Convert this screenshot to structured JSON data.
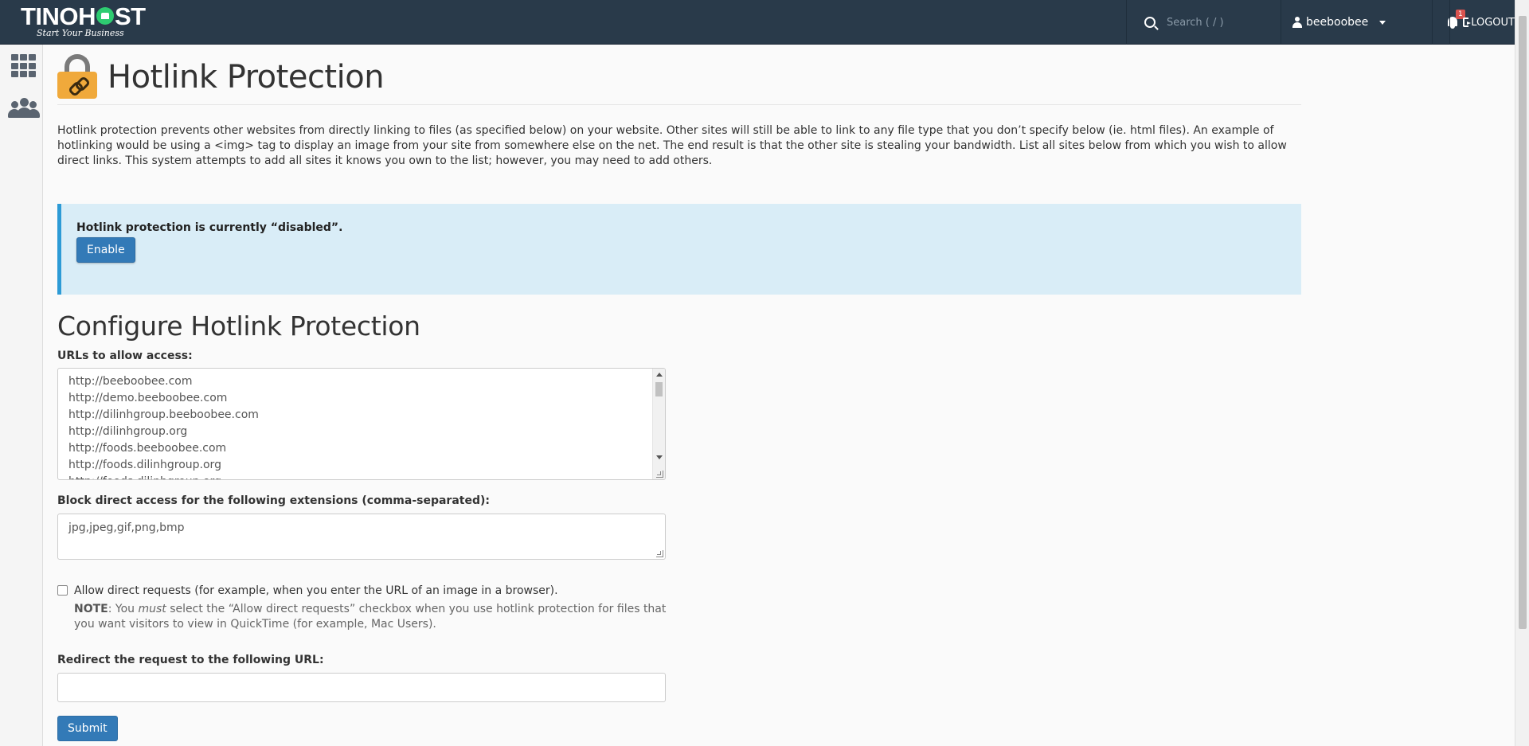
{
  "header": {
    "logo_text_left": "TINO",
    "logo_text_h": "H",
    "logo_text_right": "ST",
    "logo_tagline": "Start Your Business",
    "search_placeholder": "Search ( / )",
    "username": "beeboobee",
    "notification_count": "1",
    "logout_label": "LOGOUT"
  },
  "sidebar": {
    "items": [
      {
        "icon": "grid-icon"
      },
      {
        "icon": "users-icon"
      }
    ]
  },
  "page": {
    "title": "Hotlink Protection",
    "description": "Hotlink protection prevents other websites from directly linking to files (as specified below) on your website. Other sites will still be able to link to any file type that you don’t specify below (ie. html files). An example of hotlinking would be using a <img> tag to display an image from your site from somewhere else on the net. The end result is that the other site is stealing your bandwidth. List all sites below from which you wish to allow direct links. This system attempts to add all sites it knows you own to the list; however, you may need to add others."
  },
  "status": {
    "text": "Hotlink protection is currently “disabled”.",
    "enable_label": "Enable",
    "accent": "#2d9bd6",
    "background": "#d9edf7"
  },
  "config": {
    "title": "Configure Hotlink Protection",
    "urls_label": "URLs to allow access:",
    "urls": [
      "http://beeboobee.com",
      "http://demo.beeboobee.com",
      "http://dilinhgroup.beeboobee.com",
      "http://dilinhgroup.org",
      "http://foods.beeboobee.com",
      "http://foods.dilinhgroup.org",
      "http://foods.dilinhgroup.org"
    ],
    "extensions_label": "Block direct access for the following extensions (comma-separated):",
    "extensions_value": "jpg,jpeg,gif,png,bmp",
    "allow_direct_label": "Allow direct requests (for example, when you enter the URL of an image in a browser).",
    "note_prefix": "NOTE",
    "note_part1": ": You ",
    "note_emphasis": "must",
    "note_part2": " select the “Allow direct requests” checkbox when you use hotlink protection for files that you want visitors to view in QuickTime (for example, Mac Users).",
    "redirect_label": "Redirect the request to the following URL:",
    "redirect_value": "",
    "submit_label": "Submit"
  },
  "colors": {
    "navbar": "#293a4a",
    "primary": "#337ab7"
  }
}
